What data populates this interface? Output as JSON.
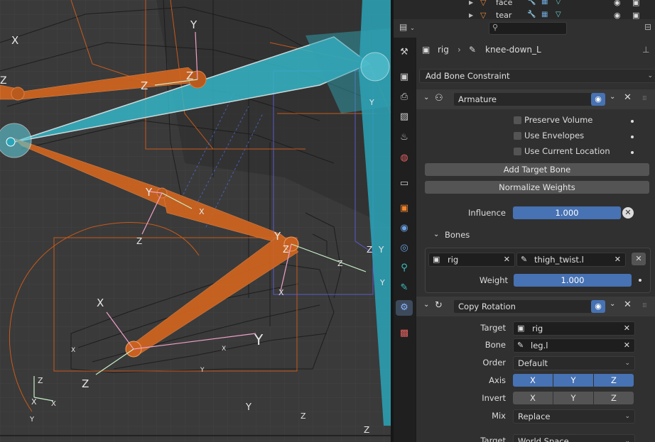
{
  "viewport": {
    "axis_labels": [
      "X",
      "Y",
      "Z",
      "Z",
      "Y",
      "X",
      "Z",
      "Y",
      "Z",
      "X",
      "Y",
      "Z",
      "Y",
      "Z",
      "Y",
      "X",
      "Z",
      "Y",
      "X",
      "Z",
      "Z",
      "Y",
      "X",
      "Z",
      "X",
      "Y",
      "X",
      "Y",
      "Z"
    ],
    "colors": {
      "bone_orange": "#d4661f",
      "bone_cyan": "#35b5c6",
      "background": "#3a3a3a",
      "wire": "#1a1a1a"
    }
  },
  "outliner": {
    "rows": [
      {
        "name": "face"
      },
      {
        "name": "tear"
      }
    ]
  },
  "header": {
    "editor_icon": "properties-editor-icon",
    "search_placeholder": ""
  },
  "breadcrumb": {
    "object": "rig",
    "bone": "knee-down_L"
  },
  "add_constraint_label": "Add Bone Constraint",
  "armature_constraint": {
    "name": "Armature",
    "options": [
      {
        "label": "Preserve Volume",
        "checked": false
      },
      {
        "label": "Use Envelopes",
        "checked": false
      },
      {
        "label": "Use Current Location",
        "checked": false
      }
    ],
    "add_target_bone_label": "Add Target Bone",
    "normalize_weights_label": "Normalize Weights",
    "influence_label": "Influence",
    "influence_value": "1.000",
    "bones_section_label": "Bones",
    "bone_target": {
      "object": "rig",
      "bone": "thigh_twist.l",
      "weight_label": "Weight",
      "weight_value": "1.000"
    }
  },
  "copy_rotation_constraint": {
    "name": "Copy Rotation",
    "target_label": "Target",
    "target_value": "rig",
    "bone_label": "Bone",
    "bone_value": "leg.l",
    "order_label": "Order",
    "order_value": "Default",
    "axis_label": "Axis",
    "axis_buttons": [
      "X",
      "Y",
      "Z"
    ],
    "invert_label": "Invert",
    "invert_buttons": [
      "X",
      "Y",
      "Z"
    ],
    "mix_label": "Mix",
    "mix_value": "Replace",
    "target_space_label": "Target",
    "target_space_value": "World Space"
  },
  "tabs": [
    "tool-icon",
    "render-icon",
    "output-icon",
    "view-layer-icon",
    "scene-icon",
    "world-icon",
    "collection-icon",
    "object-icon",
    "modifier-icon",
    "particles-icon",
    "physics-icon",
    "constraints-icon",
    "data-icon",
    "bone-icon",
    "bone-constraint-icon",
    "texture-icon"
  ]
}
